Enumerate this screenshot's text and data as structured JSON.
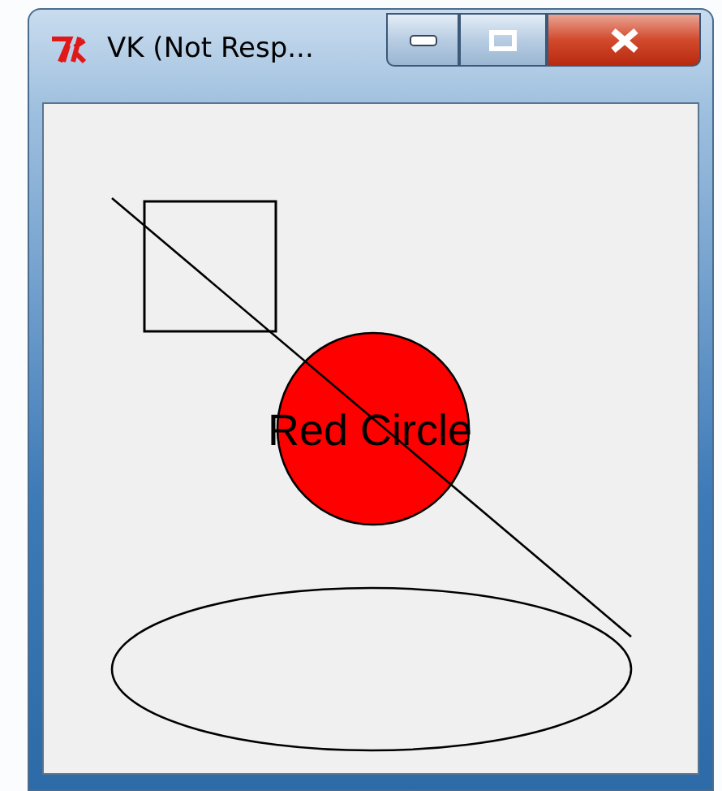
{
  "window": {
    "title": "VK (Not Resp..."
  },
  "canvas": {
    "shapes": [
      {
        "kind": "rectangle"
      },
      {
        "kind": "oval",
        "color": "#ff0000"
      },
      {
        "kind": "text",
        "text": "Red Circle"
      },
      {
        "kind": "line"
      },
      {
        "kind": "oval"
      }
    ]
  }
}
